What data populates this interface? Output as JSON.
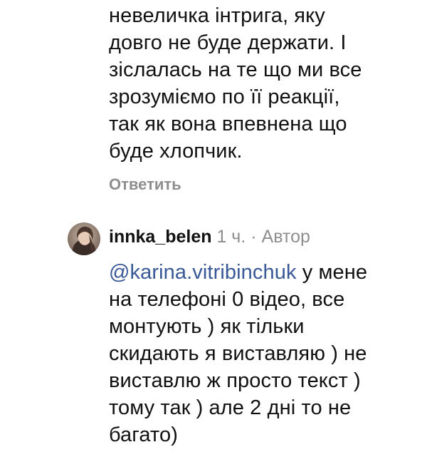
{
  "comment_1": {
    "lines": [
      "невеличка інтрига, яку",
      "довго не буде держати. І",
      "зіслалась на те що ми все",
      "зрозуміємо по її реакції,",
      "так як вона впевнена що",
      "буде хлопчик."
    ],
    "reply_label": "Ответить"
  },
  "comment_2": {
    "username": "innka_belen",
    "time": "1 ч.",
    "separator": "·",
    "author_badge": "Автор",
    "mention": "@karina.vitribinchuk",
    "first_line_rest": " у мене",
    "lines": [
      "на телефоні 0 відео, все",
      "монтують ) як тільки",
      "скидають я виставляю ) не",
      "виставлю ж просто текст )",
      "тому так ) але 2 дні то не",
      "багато)"
    ],
    "avatar_icon": "user-avatar-photo"
  },
  "colors": {
    "text": "#111111",
    "secondary": "#8e8e8e",
    "mention": "#385898",
    "background": "#ffffff"
  }
}
